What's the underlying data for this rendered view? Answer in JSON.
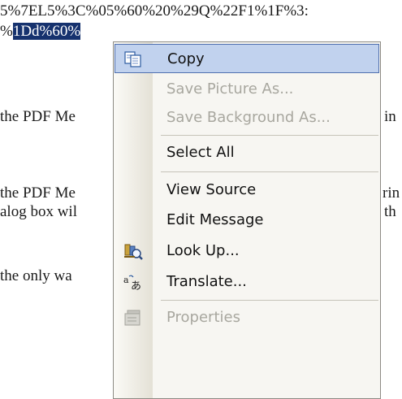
{
  "page_text": {
    "lines": [
      {
        "pre": "5%7EL5%3C%05%60%20%29Q%22F1%1F%3:",
        "sel": ""
      },
      {
        "pre": "%",
        "sel": "1Dd%60%"
      },
      {
        "pre": "the PDF Me",
        "sel": ""
      },
      {
        "pre": "the PDF Me",
        "sel": ""
      },
      {
        "pre": "alog box wil",
        "sel": ""
      },
      {
        "pre": "the only wa",
        "sel": ""
      }
    ],
    "right_fragments": [
      "in",
      "rin",
      "th"
    ]
  },
  "context_menu": {
    "items": [
      {
        "label": "Copy",
        "icon": "copy-icon",
        "state": "highlighted"
      },
      {
        "label": "Save Picture As...",
        "state": "disabled"
      },
      {
        "label": "Save Background As...",
        "state": "disabled"
      },
      {
        "label": "Select All",
        "state": "enabled"
      },
      {
        "label": "View Source",
        "state": "enabled"
      },
      {
        "label": "Edit Message",
        "state": "enabled"
      },
      {
        "label": "Look Up...",
        "icon": "research-icon",
        "state": "enabled"
      },
      {
        "label": "Translate...",
        "icon": "translate-icon",
        "state": "enabled"
      },
      {
        "label": "Properties",
        "icon": "properties-icon",
        "state": "disabled"
      }
    ]
  },
  "colors": {
    "selection": "#16326e",
    "menu_highlight": "#c1d2ee",
    "menu_background": "#f7f6f2",
    "disabled_text": "#a8a79f"
  }
}
